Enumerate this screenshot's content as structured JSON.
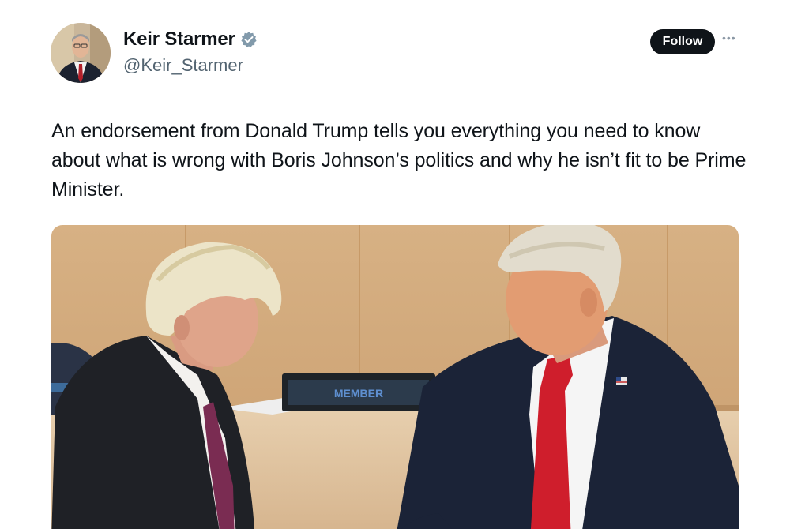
{
  "author": {
    "name": "Keir Starmer",
    "handle": "@Keir_Starmer",
    "verified_icon": "verified-badge-icon",
    "verified_color": "#829aab"
  },
  "actions": {
    "follow_label": "Follow",
    "more_icon": "more-options-icon"
  },
  "tweet": {
    "text": "An endorsement from Donald Trump tells you everything you need to know about what is wrong with Boris Johnson’s politics and why he isn’t fit to be Prime Minister."
  },
  "media": {
    "nameplate_text": "MEMBER"
  },
  "colors": {
    "text": "#0f1419",
    "secondary_text": "#536471",
    "follow_bg": "#0f1419",
    "follow_fg": "#ffffff"
  }
}
